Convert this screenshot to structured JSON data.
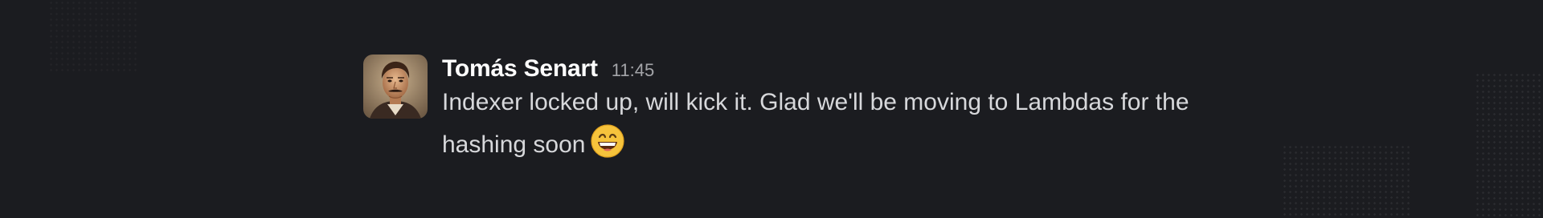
{
  "message": {
    "author": "Tomás Senart",
    "time": "11:45",
    "text": "Indexer locked up, will kick it. Glad we'll be moving to Lambdas for the hashing soon",
    "emoji": "grinning-face-with-smiling-eyes"
  },
  "colors": {
    "background": "#1b1c20",
    "author": "#ffffff",
    "timestamp": "#a3a4a8",
    "body_text": "#d7d8db"
  }
}
